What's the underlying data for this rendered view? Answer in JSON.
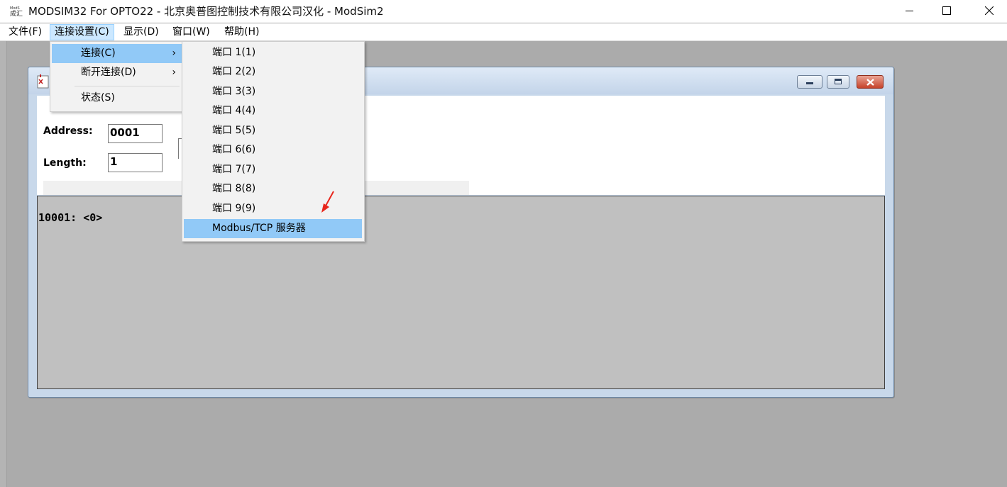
{
  "window": {
    "title": "MODSIM32 For OPTO22 - 北京奥普图控制技术有限公司汉化 - ModSim2",
    "icon_label": "成汇"
  },
  "menubar": {
    "items": [
      {
        "label": "文件(F)"
      },
      {
        "label": "连接设置(C)"
      },
      {
        "label": "显示(D)"
      },
      {
        "label": "窗口(W)"
      },
      {
        "label": "帮助(H)"
      }
    ]
  },
  "connection_menu": {
    "items": [
      {
        "label": "连接(C)",
        "has_submenu": true
      },
      {
        "label": "断开连接(D)",
        "has_submenu": true
      },
      {
        "label": "状态(S)",
        "has_submenu": false
      }
    ]
  },
  "connect_submenu": {
    "items": [
      {
        "label": "端口 1(1)"
      },
      {
        "label": "端口 2(2)"
      },
      {
        "label": "端口 3(3)"
      },
      {
        "label": "端口 4(4)"
      },
      {
        "label": "端口 5(5)"
      },
      {
        "label": "端口 6(6)"
      },
      {
        "label": "端口 7(7)"
      },
      {
        "label": "端口 8(8)"
      },
      {
        "label": "端口 9(9)"
      },
      {
        "label": "Modbus/TCP 服务器"
      }
    ]
  },
  "child_window": {
    "address_label": "Address:",
    "address_value": "0001",
    "length_label": "Length:",
    "length_value": "1",
    "data_line": "10001: <0>"
  },
  "colors": {
    "menu_highlight": "#91c9f7",
    "menubar_active": "#cce8ff",
    "annotation_arrow": "#e8261c"
  }
}
